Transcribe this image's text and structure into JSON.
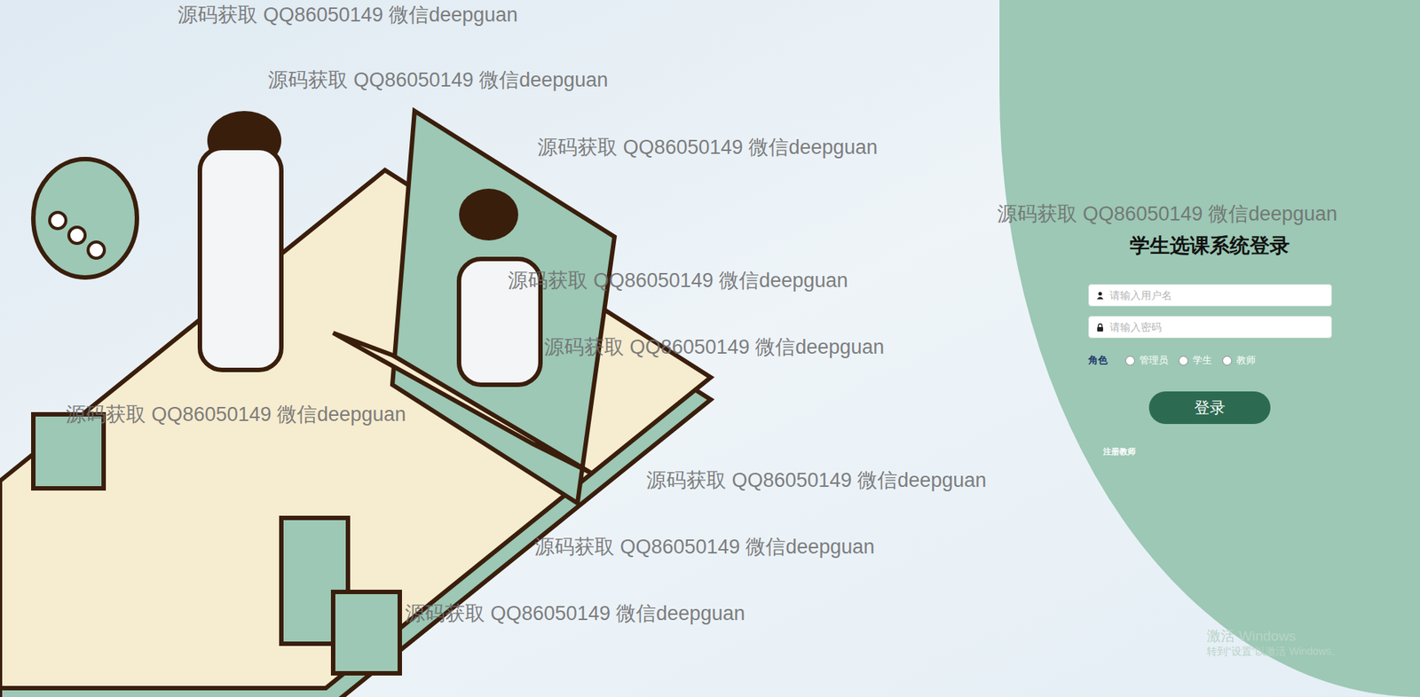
{
  "login": {
    "title": "学生选课系统登录",
    "username_placeholder": "请输入用户名",
    "password_placeholder": "请输入密码",
    "role_label": "角色",
    "roles": [
      {
        "label": "管理员",
        "selected": false
      },
      {
        "label": "学生",
        "selected": false
      },
      {
        "label": "教师",
        "selected": false
      }
    ],
    "submit": "登录",
    "register_link": "注册教师"
  },
  "watermarks": [
    "源码获取 QQ86050149 微信deepguan",
    "源码获取 QQ86050149 微信deepguan",
    "源码获取 QQ86050149 微信deepguan",
    "源码获取 QQ86050149 微信deepguan",
    "源码获取 QQ86050149 微信deepguan",
    "源码获取 QQ86050149 微信deepguan",
    "源码获取 QQ86050149 微信deepguan",
    "源码获取 QQ86050149 微信deepguan",
    "源码获取 QQ86050149 微信deepguan",
    "源码获取 QQ86050149 微信deepguan"
  ],
  "os_watermark": {
    "line1": "激活 Windows",
    "line2": "转到“设置”以激活 Windows。"
  }
}
